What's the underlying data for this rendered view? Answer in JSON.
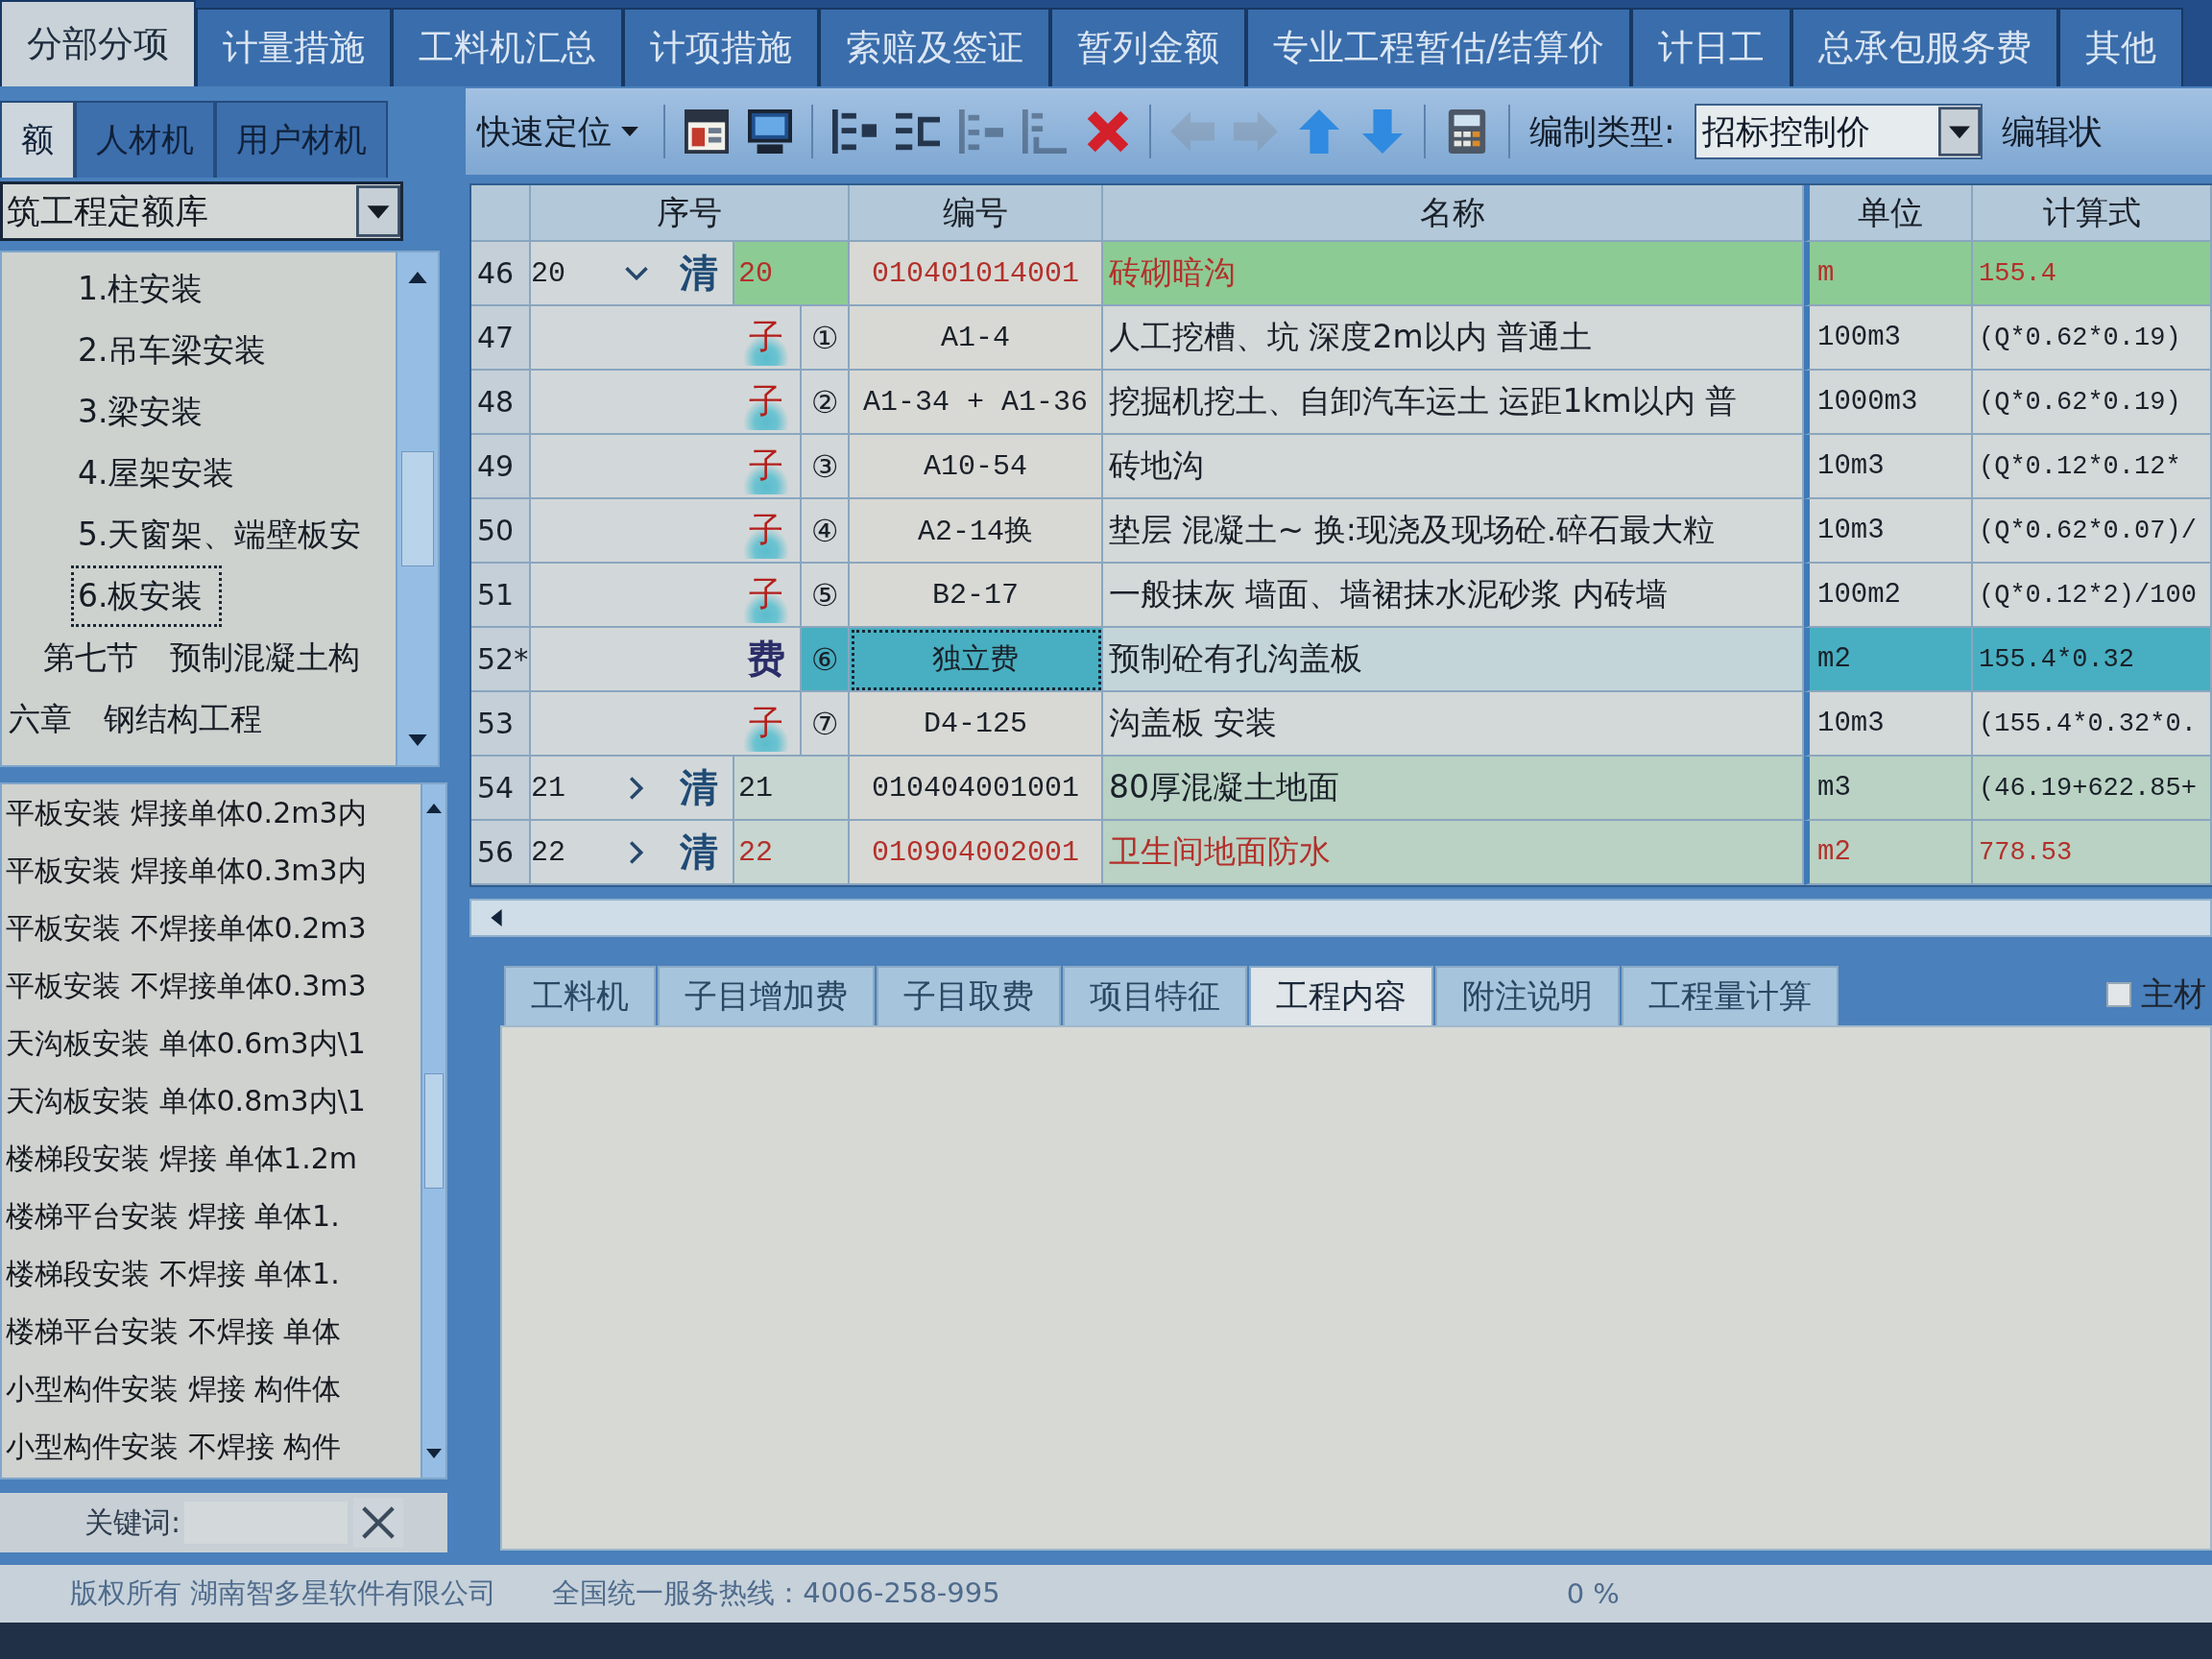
{
  "top_tabs": [
    {
      "label": "分部分项",
      "selected": true
    },
    {
      "label": "计量措施",
      "selected": false
    },
    {
      "label": "工料机汇总",
      "selected": false
    },
    {
      "label": "计项措施",
      "selected": false
    },
    {
      "label": "索赔及签证",
      "selected": false
    },
    {
      "label": "暂列金额",
      "selected": false
    },
    {
      "label": "专业工程暂估/结算价",
      "selected": false
    },
    {
      "label": "计日工",
      "selected": false
    },
    {
      "label": "总承包服务费",
      "selected": false
    },
    {
      "label": "其他",
      "selected": false
    }
  ],
  "library_tabs": [
    {
      "label": "额",
      "selected": true
    },
    {
      "label": "人材机",
      "selected": false
    },
    {
      "label": "用户材机",
      "selected": false
    }
  ],
  "toolbar": {
    "locate_button": "快速定位",
    "buttons": [
      {
        "kind": "window",
        "disabled": false
      },
      {
        "kind": "monitor",
        "disabled": false
      },
      {
        "kind": "indent",
        "disabled": false
      },
      {
        "kind": "outdent",
        "disabled": false
      },
      {
        "kind": "branch",
        "disabled": true
      },
      {
        "kind": "corner",
        "disabled": true
      },
      {
        "kind": "delete",
        "disabled": false
      },
      {
        "kind": "left",
        "disabled": true
      },
      {
        "kind": "right",
        "disabled": true
      },
      {
        "kind": "up",
        "disabled": false
      },
      {
        "kind": "down",
        "disabled": false
      },
      {
        "kind": "calculator",
        "disabled": false
      }
    ],
    "type_label": "编制类型:",
    "type_value": "招标控制价",
    "status_label": "编辑状"
  },
  "library": {
    "selector": "筑工程定额库",
    "tree": [
      {
        "children": [
          {
            "children": [
              {
                "label": "1.柱安装",
                "selected": false
              },
              {
                "label": "2.吊车梁安装",
                "selected": false
              },
              {
                "label": "3.梁安装",
                "selected": false
              },
              {
                "label": "4.屋架安装",
                "selected": false
              },
              {
                "label": "5.天窗架、端壁板安",
                "selected": false
              },
              {
                "label": "6.板安装",
                "selected": true
              }
            ]
          },
          {
            "label": "第七节　预制混凝土构",
            "selected": false
          }
        ]
      },
      {
        "label": "六章　钢结构工程",
        "selected": false
      }
    ],
    "items": [
      "平板安装 焊接单体0.2m3内",
      "平板安装 焊接单体0.3m3内",
      "平板安装 不焊接单体0.2m3",
      "平板安装 不焊接单体0.3m3",
      "天沟板安装 单体0.6m3内\\1",
      "天沟板安装 单体0.8m3内\\1",
      "楼梯段安装 焊接 单体1.2m",
      "楼梯平台安装 焊接 单体1.",
      "楼梯段安装 不焊接 单体1.",
      "楼梯平台安装 不焊接 单体",
      "小型构件安装 焊接 构件体",
      "小型构件安装 不焊接 构件"
    ],
    "keyword_label": "关键词:"
  },
  "table": {
    "columns": [
      "序号",
      "编号",
      "名称",
      "单位",
      "计算式"
    ],
    "rows": [
      {
        "kind": "bill",
        "row_no": "46",
        "seq": "20",
        "mark": "清",
        "expanded": true,
        "flagged": true,
        "selected": false,
        "number": "20",
        "code": "010401014001",
        "name": "砖砌暗沟",
        "unit": "m",
        "formula": "155.4",
        "children": [
          {
            "kind": "sub",
            "row_no": "47",
            "mark": "子",
            "selected": false,
            "number": "①",
            "code": "A1-4",
            "name": "人工挖槽、坑 深度2m以内 普通土",
            "unit": "100m3",
            "formula": "(Q*0.62*0.19)"
          },
          {
            "kind": "sub",
            "row_no": "48",
            "mark": "子",
            "selected": false,
            "number": "②",
            "code": "A1-34 + A1-36",
            "name": "挖掘机挖土、自卸汽车运土 运距1km以内 普",
            "unit": "1000m3",
            "formula": "(Q*0.62*0.19)"
          },
          {
            "kind": "sub",
            "row_no": "49",
            "mark": "子",
            "selected": false,
            "number": "③",
            "code": "A10-54",
            "name": "砖地沟",
            "unit": "10m3",
            "formula": "(Q*0.12*0.12*"
          },
          {
            "kind": "sub",
            "row_no": "50",
            "mark": "子",
            "selected": false,
            "number": "④",
            "code": "A2-14换",
            "name": "垫层 混凝土~ 换:现浇及现场砼.碎石最大粒",
            "unit": "10m3",
            "formula": "(Q*0.62*0.07)/"
          },
          {
            "kind": "sub",
            "row_no": "51",
            "mark": "子",
            "selected": false,
            "number": "⑤",
            "code": "B2-17",
            "name": "一般抹灰 墙面、墙裙抹水泥砂浆 内砖墙",
            "unit": "100m2",
            "formula": "(Q*0.12*2)/100"
          },
          {
            "kind": "fee",
            "row_no": "52*",
            "mark": "费",
            "selected": true,
            "number": "⑥",
            "code": "独立费",
            "name": "预制砼有孔沟盖板",
            "unit": "m2",
            "formula": "155.4*0.32"
          },
          {
            "kind": "sub",
            "row_no": "53",
            "mark": "子",
            "selected": false,
            "number": "⑦",
            "code": "D4-125",
            "name": "沟盖板 安装",
            "unit": "10m3",
            "formula": "(155.4*0.32*0."
          }
        ]
      },
      {
        "kind": "bill",
        "row_no": "54",
        "seq": "21",
        "mark": "清",
        "expanded": false,
        "flagged": false,
        "selected": false,
        "number": "21",
        "code": "010404001001",
        "name": "80厚混凝土地面",
        "unit": "m3",
        "formula": "(46.19+622.85+"
      },
      {
        "kind": "bill",
        "row_no": "56",
        "seq": "22",
        "mark": "清",
        "expanded": false,
        "flagged": true,
        "selected": false,
        "number": "22",
        "code": "010904002001",
        "name": "卫生间地面防水",
        "unit": "m2",
        "formula": "778.53"
      }
    ]
  },
  "detail_tabs": [
    {
      "label": "工料机",
      "selected": false
    },
    {
      "label": "子目增加费",
      "selected": false
    },
    {
      "label": "子目取费",
      "selected": false
    },
    {
      "label": "项目特征",
      "selected": false
    },
    {
      "label": "工程内容",
      "selected": true
    },
    {
      "label": "附注说明",
      "selected": false
    },
    {
      "label": "工程量计算",
      "selected": false
    }
  ],
  "main_material": {
    "label": "主材",
    "checked": false
  },
  "status_bar": {
    "copyright": "版权所有 湖南智多星软件有限公司",
    "hotline": "全国统一服务热线：4006-258-995",
    "progress": "0 %"
  }
}
